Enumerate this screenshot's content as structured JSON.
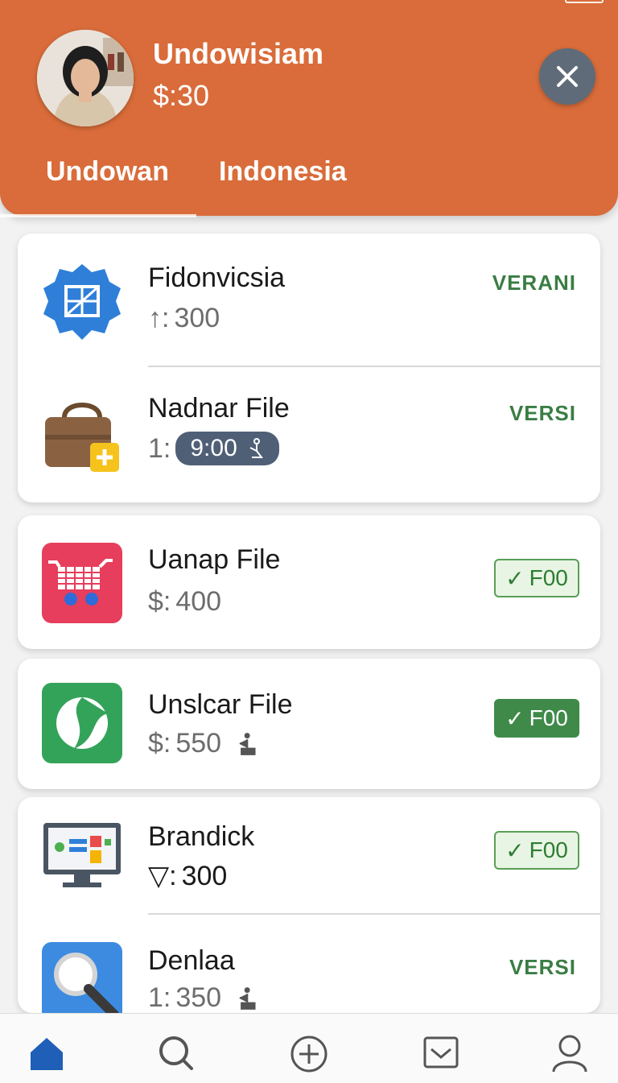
{
  "header": {
    "user_name": "Undowisiam",
    "balance": "$:30",
    "tabs": [
      "Undowan",
      "Indonesia"
    ]
  },
  "colors": {
    "header_bg": "#d96c3a",
    "accent_green": "#3a7d44",
    "close_bg": "#5f6b78",
    "nav_active": "#1f5fb8"
  },
  "items": [
    {
      "title": "Fidonvicsia",
      "prefix": "↑: ",
      "amount": "300",
      "status": "VERANI",
      "icon": "gallery-badge-icon"
    },
    {
      "title": "Nadnar File",
      "prefix": "1:",
      "time": "9:00",
      "status": "VERSI",
      "icon": "bag-add-icon"
    },
    {
      "title": "Uanap File",
      "prefix": "$:",
      "amount": "400",
      "badge": "F00",
      "icon": "cart-icon"
    },
    {
      "title": "Unslcar File",
      "prefix": "$:",
      "amount": "550",
      "badge": "F00",
      "icon": "green-swirl-icon"
    },
    {
      "title": "Brandick",
      "prefix": "▽:",
      "amount": "300",
      "badge": "F00",
      "icon": "monitor-dashboard-icon"
    },
    {
      "title": "Denlaa",
      "prefix": "1:",
      "amount": "350",
      "status": "VERSI",
      "icon": "magnifier-icon"
    }
  ],
  "nav": [
    "home-icon",
    "search-icon",
    "add-circle-icon",
    "inbox-icon",
    "profile-icon"
  ]
}
